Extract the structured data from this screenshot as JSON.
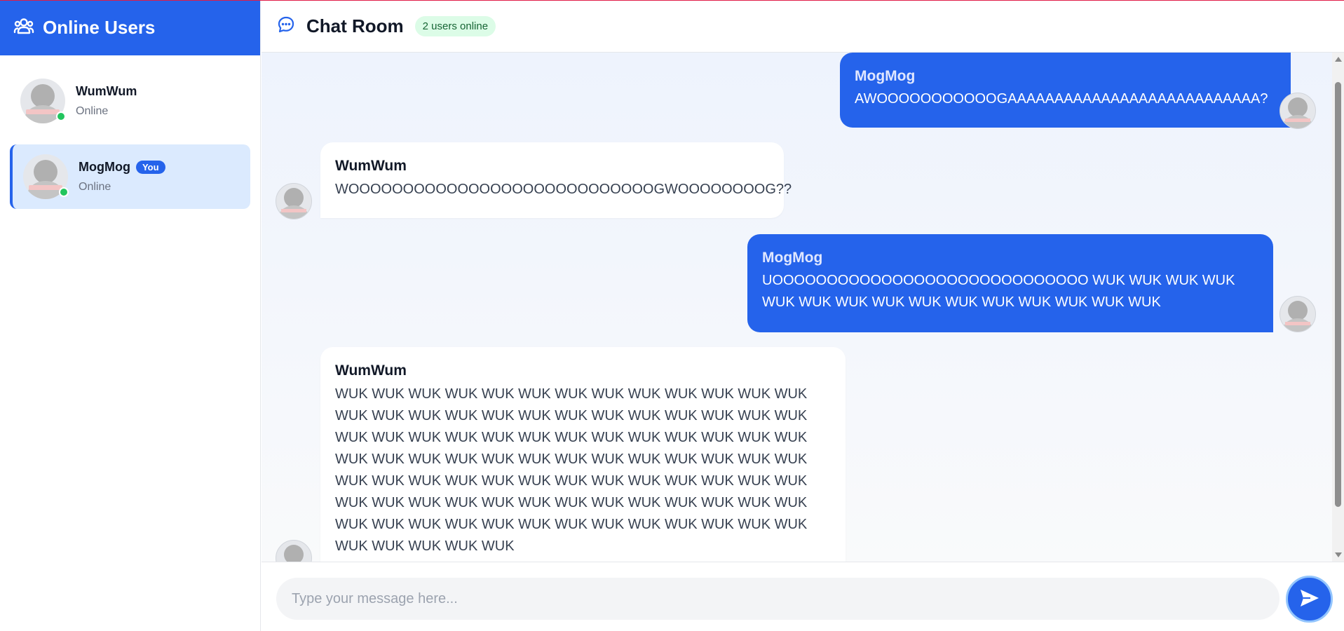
{
  "sidebar": {
    "title": "Online Users",
    "icon": "users-icon",
    "users": [
      {
        "name": "WumWum",
        "status": "Online",
        "is_you": false
      },
      {
        "name": "MogMog",
        "status": "Online",
        "is_you": true,
        "you_badge": "You"
      }
    ]
  },
  "header": {
    "icon": "chat-bubble-icon",
    "title": "Chat Room",
    "online_count": "2 users online"
  },
  "messages": [
    {
      "sender": "MogMog",
      "text": "AWOOOOOOOOOOOGAAAAAAAAAAAAAAAAAAAAAAAAAAA?",
      "mine": true
    },
    {
      "sender": "WumWum",
      "text": "WOOOOOOOOOOOOOOOOOOOOOOOOOOOOGWOOOOOOOOG??",
      "mine": false
    },
    {
      "sender": "MogMog",
      "text": "UOOOOOOOOOOOOOOOOOOOOOOOOOOOOO WUK WUK WUK WUK WUK WUK WUK WUK WUK WUK WUK WUK WUK WUK WUK",
      "mine": true
    },
    {
      "sender": "WumWum",
      "text": "WUK WUK WUK WUK WUK WUK WUK WUK WUK WUK WUK WUK WUK WUK WUK WUK WUK WUK WUK WUK WUK WUK WUK WUK WUK WUK WUK WUK WUK WUK WUK WUK WUK WUK WUK WUK WUK WUK WUK WUK WUK WUK WUK WUK WUK WUK WUK WUK WUK WUK WUK WUK WUK WUK WUK WUK WUK WUK WUK WUK WUK WUK WUK WUK WUK WUK WUK WUK WUK WUK WUK WUK WUK WUK WUK WUK WUK WUK WUK WUK WUK WUK WUK WUK WUK WUK WUK WUK WUK WUK WUK WUK WUK WUK WUK WUK",
      "mine": false
    }
  ],
  "input": {
    "placeholder": "Type your message here..."
  },
  "send_button": {
    "icon": "send-icon"
  },
  "colors": {
    "primary": "#2563eb",
    "online": "#22c55e",
    "badge_bg": "#dcfce7"
  }
}
